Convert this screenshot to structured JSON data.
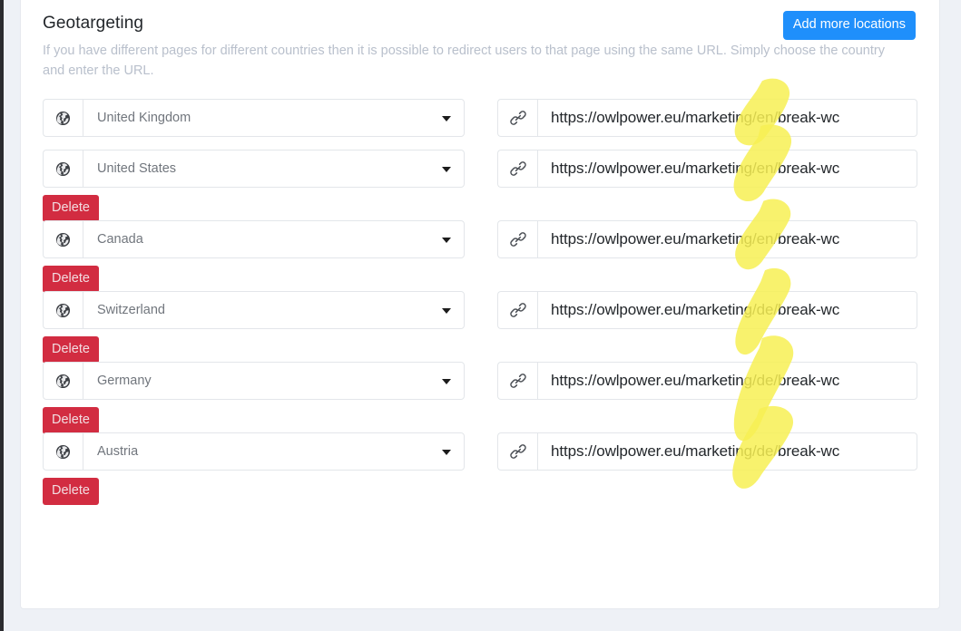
{
  "header": {
    "title": "Geotargeting",
    "description": "If you have different pages for different countries then it is possible to redirect users to that page using the same URL. Simply choose the country and enter the URL.",
    "add_button_label": "Add more locations"
  },
  "labels": {
    "delete": "Delete",
    "globe_icon": "globe-icon",
    "link_icon": "link-icon",
    "caret_icon": "chevron-down-icon"
  },
  "colors": {
    "accent_blue": "#1f8ffb",
    "danger_red": "#d22c41",
    "highlighter_yellow": "#f7f053",
    "page_background": "#eef1f6",
    "card_background": "#ffffff",
    "muted_text": "#b9c0cc"
  },
  "rows": [
    {
      "country": "United Kingdom",
      "url": "https://owlpower.eu/marketing/en/break-wc",
      "highlighted_segment": "en",
      "deletable": false,
      "delete_label": ""
    },
    {
      "country": "United States",
      "url": "https://owlpower.eu/marketing/en/break-wc",
      "highlighted_segment": "en",
      "deletable": true,
      "delete_label": "Delete"
    },
    {
      "country": "Canada",
      "url": "https://owlpower.eu/marketing/en/break-wc",
      "highlighted_segment": "en",
      "deletable": true,
      "delete_label": "Delete"
    },
    {
      "country": "Switzerland",
      "url": "https://owlpower.eu/marketing/de/break-wc",
      "highlighted_segment": "de",
      "deletable": true,
      "delete_label": "Delete"
    },
    {
      "country": "Germany",
      "url": "https://owlpower.eu/marketing/de/break-wc",
      "highlighted_segment": "de",
      "deletable": true,
      "delete_label": "Delete"
    },
    {
      "country": "Austria",
      "url": "https://owlpower.eu/marketing/de/break-wc",
      "highlighted_segment": "de",
      "deletable": true,
      "delete_label": "Delete"
    }
  ]
}
